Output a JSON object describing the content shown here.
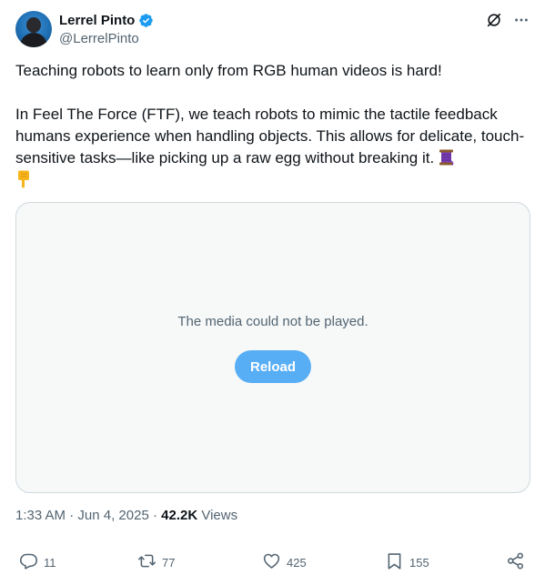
{
  "author": {
    "display_name": "Lerrel Pinto",
    "handle": "@LerrelPinto"
  },
  "header_icons": [
    "grok-icon",
    "more-icon"
  ],
  "tweet": {
    "paragraph1": "Teaching robots to learn only from RGB human videos is hard!",
    "paragraph2": "In Feel The Force (FTF), we teach robots to mimic the tactile feedback humans experience when handling objects. This allows for delicate, touch-sensitive tasks—like picking up a raw egg without breaking it.",
    "emojis": [
      "thread-spool-emoji",
      "pointing-down-emoji"
    ]
  },
  "media": {
    "message": "The media could not be played.",
    "reload_label": "Reload"
  },
  "meta": {
    "time": "1:33 AM",
    "separator": "·",
    "date": "Jun 4, 2025",
    "views_count": "42.2K",
    "views_label": "Views"
  },
  "actions": {
    "replies": "11",
    "reposts": "77",
    "likes": "425",
    "bookmarks": "155"
  },
  "colors": {
    "accent": "#1d9bf0",
    "reload_button": "#58aef5",
    "muted_text": "#536471",
    "media_bg": "#f7f9f9"
  }
}
